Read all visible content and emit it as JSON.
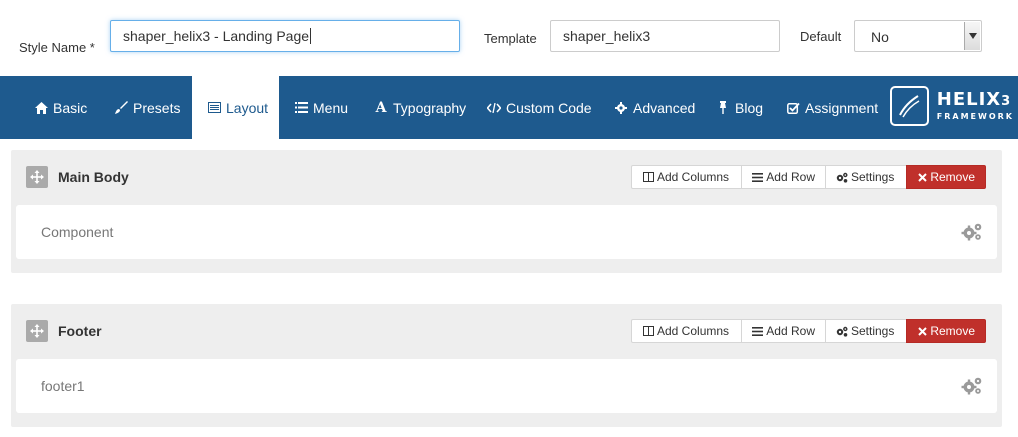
{
  "form": {
    "style_name_label": "Style Name *",
    "style_name_value": "shaper_helix3 - Landing Page",
    "template_label": "Template",
    "template_value": "shaper_helix3",
    "default_label": "Default",
    "default_value": "No"
  },
  "nav": {
    "tabs": [
      {
        "label": "Basic",
        "icon": "home-icon"
      },
      {
        "label": "Presets",
        "icon": "paint-brush-icon"
      },
      {
        "label": "Layout",
        "icon": "layout-list-icon",
        "active": true
      },
      {
        "label": "Menu",
        "icon": "list-icon"
      },
      {
        "label": "Typography",
        "icon": "font-icon"
      },
      {
        "label": "Custom Code",
        "icon": "code-icon"
      },
      {
        "label": "Advanced",
        "icon": "cog-icon"
      },
      {
        "label": "Blog",
        "icon": "pushpin-icon"
      },
      {
        "label": "Assignment",
        "icon": "check-square-icon"
      }
    ],
    "logo": {
      "main": "HELIX",
      "version": "3",
      "sub": "FRAMEWORK"
    }
  },
  "sections": [
    {
      "title": "Main Body",
      "row_label": "Component",
      "buttons": {
        "add_columns": "Add Columns",
        "add_row": "Add Row",
        "settings": "Settings",
        "remove": "Remove"
      }
    },
    {
      "title": "Footer",
      "row_label": "footer1",
      "buttons": {
        "add_columns": "Add Columns",
        "add_row": "Add Row",
        "settings": "Settings",
        "remove": "Remove"
      }
    }
  ],
  "colors": {
    "nav_bg": "#1e5a8e",
    "remove_bg": "#c0302b",
    "section_bg": "#eeeeee"
  }
}
